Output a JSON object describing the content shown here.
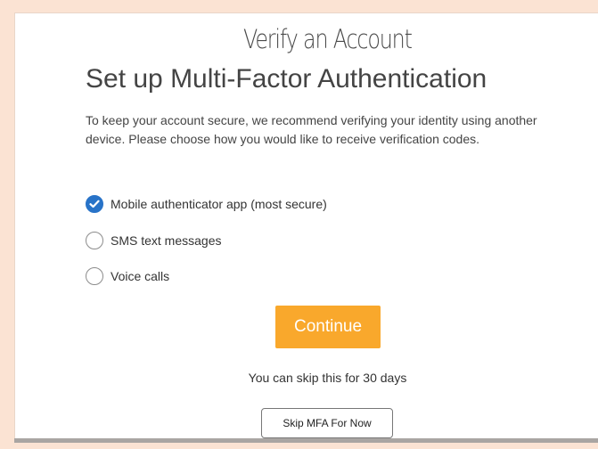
{
  "header": {
    "title": "Verify an Account"
  },
  "main": {
    "section_title": "Set up Multi-Factor Authentication",
    "description": "To keep your account secure, we recommend verifying your identity using another device. Please choose how you would like to receive verification codes.",
    "options": [
      {
        "label": "Mobile authenticator app (most secure)",
        "selected": true
      },
      {
        "label": "SMS text messages",
        "selected": false
      },
      {
        "label": "Voice calls",
        "selected": false
      }
    ],
    "continue_label": "Continue",
    "skip_note": "You can skip this for 30 days",
    "skip_label": "Skip MFA For Now"
  },
  "colors": {
    "background": "#fbe3d3",
    "accent": "#f9a82c",
    "radio_checked": "#2873c8"
  }
}
